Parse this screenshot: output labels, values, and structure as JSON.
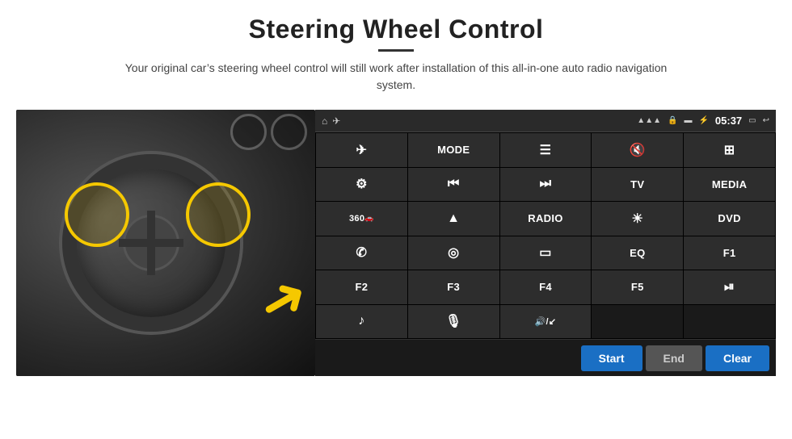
{
  "header": {
    "title": "Steering Wheel Control",
    "subtitle": "Your original car’s steering wheel control will still work after installation of this all-in-one auto radio navigation system.",
    "divider": true
  },
  "status_bar": {
    "time": "05:37",
    "icons": [
      "home",
      "wifi",
      "lock",
      "sd",
      "bluetooth",
      "screen-record",
      "back"
    ]
  },
  "button_grid": [
    [
      {
        "label": "✈",
        "type": "icon",
        "name": "nav-icon"
      },
      {
        "label": "MODE",
        "type": "text",
        "name": "mode-btn"
      },
      {
        "label": "≡",
        "type": "icon",
        "name": "menu-icon"
      },
      {
        "label": "🔇",
        "type": "icon",
        "name": "mute-icon"
      },
      {
        "label": "⊞",
        "type": "icon",
        "name": "apps-icon"
      }
    ],
    [
      {
        "label": "⚙",
        "type": "icon",
        "name": "settings-icon"
      },
      {
        "label": "⏮",
        "type": "icon",
        "name": "prev-icon"
      },
      {
        "label": "⏭",
        "type": "icon",
        "name": "next-icon"
      },
      {
        "label": "TV",
        "type": "text",
        "name": "tv-btn"
      },
      {
        "label": "MEDIA",
        "type": "text",
        "name": "media-btn"
      }
    ],
    [
      {
        "label": "360",
        "type": "text-sub",
        "name": "360-btn"
      },
      {
        "label": "▲",
        "type": "icon",
        "name": "eject-icon"
      },
      {
        "label": "RADIO",
        "type": "text",
        "name": "radio-btn"
      },
      {
        "label": "☀",
        "type": "icon",
        "name": "brightness-icon"
      },
      {
        "label": "DVD",
        "type": "text",
        "name": "dvd-btn"
      }
    ],
    [
      {
        "label": "📞",
        "type": "icon",
        "name": "phone-icon"
      },
      {
        "label": "🌐",
        "type": "icon",
        "name": "web-icon"
      },
      {
        "label": "▬",
        "type": "icon",
        "name": "screen-icon"
      },
      {
        "label": "EQ",
        "type": "text",
        "name": "eq-btn"
      },
      {
        "label": "F1",
        "type": "text",
        "name": "f1-btn"
      }
    ],
    [
      {
        "label": "F2",
        "type": "text",
        "name": "f2-btn"
      },
      {
        "label": "F3",
        "type": "text",
        "name": "f3-btn"
      },
      {
        "label": "F4",
        "type": "text",
        "name": "f4-btn"
      },
      {
        "label": "F5",
        "type": "text",
        "name": "f5-btn"
      },
      {
        "label": "⏯",
        "type": "icon",
        "name": "playpause-icon"
      }
    ],
    [
      {
        "label": "♪",
        "type": "icon",
        "name": "music-icon"
      },
      {
        "label": "🎙",
        "type": "icon",
        "name": "mic-icon"
      },
      {
        "label": "🔊/↙",
        "type": "icon",
        "name": "volume-call-icon"
      },
      {
        "label": "",
        "type": "empty",
        "name": "empty1"
      },
      {
        "label": "",
        "type": "empty",
        "name": "empty2"
      }
    ]
  ],
  "bottom_controls": {
    "start_label": "Start",
    "end_label": "End",
    "clear_label": "Clear"
  }
}
